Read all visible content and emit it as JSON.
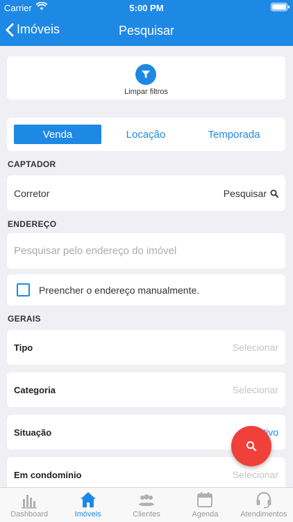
{
  "status_bar": {
    "carrier": "Carrier",
    "time": "5:00 PM"
  },
  "nav": {
    "back_label": "Imóveis",
    "title": "Pesquisar"
  },
  "filter": {
    "clear_label": "Limpar filtros"
  },
  "segments": [
    {
      "label": "Venda",
      "active": true
    },
    {
      "label": "Locação",
      "active": false
    },
    {
      "label": "Temporada",
      "active": false
    }
  ],
  "captador": {
    "section_title": "CAPTADOR",
    "corretor_label": "Corretor",
    "pesquisar_label": "Pesquisar"
  },
  "endereco": {
    "section_title": "ENDEREÇO",
    "search_placeholder": "Pesquisar pelo endereço do imóvel",
    "manual_label": "Preencher o endereço manualmente.",
    "manual_checked": false
  },
  "gerais": {
    "section_title": "GERAIS",
    "fields": [
      {
        "label": "Tipo",
        "value": "Selecionar"
      },
      {
        "label": "Categoria",
        "value": "Selecionar"
      },
      {
        "label": "Situação",
        "value": "Ativo"
      },
      {
        "label": "Em condomínio",
        "value": "Selecionar"
      }
    ]
  },
  "tabbar": {
    "items": [
      {
        "label": "Dashboard",
        "icon": "bar-chart-icon",
        "active": false
      },
      {
        "label": "Imóveis",
        "icon": "house-icon",
        "active": true
      },
      {
        "label": "Clientes",
        "icon": "people-icon",
        "active": false
      },
      {
        "label": "Agenda",
        "icon": "calendar-icon",
        "active": false
      },
      {
        "label": "Atendimentos",
        "icon": "headset-icon",
        "active": false
      }
    ]
  },
  "colors": {
    "primary": "#1e88e5",
    "fab": "#f0403a",
    "placeholder": "#c4c4c4"
  }
}
